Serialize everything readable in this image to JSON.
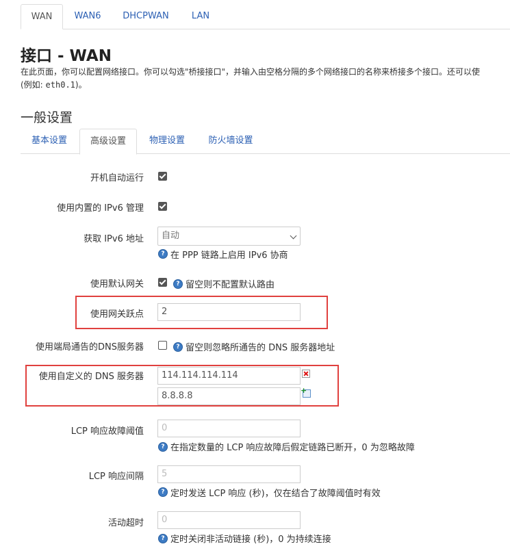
{
  "top_tabs": [
    "WAN",
    "WAN6",
    "DHCPWAN",
    "LAN"
  ],
  "page_title": "接口 - WAN",
  "description_line1": "在此页面，你可以配置网络接口。你可以勾选\"桥接接口\"，并输入由空格分隔的多个网络接口的名称来桥接多个接口。还可以使",
  "description_line2_prefix": "(例如: ",
  "description_line2_code": "eth0.1",
  "description_line2_suffix": ")。",
  "section_title": "一般设置",
  "sub_tabs": [
    "基本设置",
    "高级设置",
    "物理设置",
    "防火墙设置"
  ],
  "fields": {
    "autostart": {
      "label": "开机自动运行",
      "checked": true
    },
    "builtin_ipv6": {
      "label": "使用内置的 IPv6 管理",
      "checked": true
    },
    "ipv6_addr": {
      "label": "获取 IPv6 地址",
      "value": "自动",
      "help": "在 PPP 链路上启用 IPv6 协商"
    },
    "default_gw": {
      "label": "使用默认网关",
      "checked": true,
      "help": "留空则不配置默认路由"
    },
    "gw_metric": {
      "label": "使用网关跃点",
      "value": "2"
    },
    "peer_dns": {
      "label": "使用端局通告的DNS服务器",
      "checked": false,
      "help": "留空则忽略所通告的 DNS 服务器地址"
    },
    "custom_dns": {
      "label": "使用自定义的 DNS 服务器",
      "values": [
        "114.114.114.114",
        "8.8.8.8"
      ]
    },
    "lcp_failure": {
      "label": "LCP 响应故障阈值",
      "placeholder": "0",
      "help": "在指定数量的 LCP 响应故障后假定链路已断开，0 为忽略故障"
    },
    "lcp_interval": {
      "label": "LCP 响应间隔",
      "placeholder": "5",
      "help": "定时发送 LCP 响应 (秒)，仅在结合了故障阈值时有效"
    },
    "idle_timeout": {
      "label": "活动超时",
      "placeholder": "0",
      "help": "定时关闭非活动链接 (秒)，0 为持续连接"
    }
  },
  "help_glyph": "?",
  "icons": {
    "help": "help-circle-icon",
    "remove": "remove-entry-icon",
    "add": "add-entry-icon"
  },
  "colors": {
    "link": "#2b5fb3",
    "highlight_box": "#e0403e",
    "help_icon": "#3d7bc4"
  }
}
